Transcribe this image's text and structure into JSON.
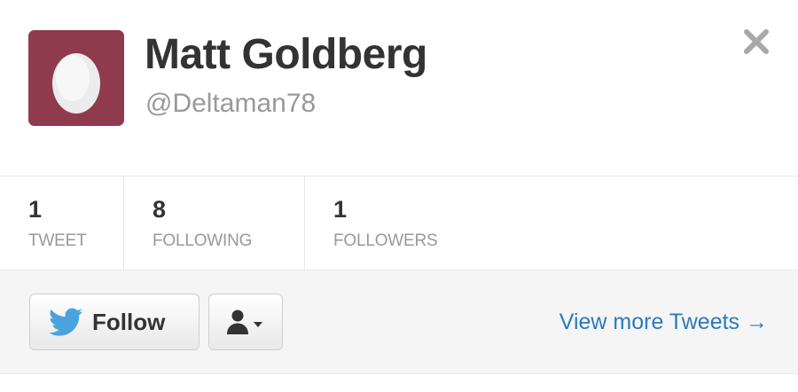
{
  "profile": {
    "name": "Matt Goldberg",
    "handle": "@Deltaman78"
  },
  "stats": [
    {
      "value": "1",
      "label": "TWEET"
    },
    {
      "value": "8",
      "label": "FOLLOWING"
    },
    {
      "value": "1",
      "label": "FOLLOWERS"
    }
  ],
  "actions": {
    "follow_label": "Follow",
    "view_more_label": "View more Tweets →"
  },
  "icons": {
    "close": "close-icon",
    "avatar": "default-egg-avatar",
    "follow": "twitter-bird-icon",
    "user_menu": "user-icon",
    "dropdown": "caret-down-icon"
  },
  "colors": {
    "avatar_bg": "#8f3b4d",
    "link": "#2b7bb9",
    "bird": "#4aa3df",
    "text": "#333333",
    "muted": "#999999"
  }
}
